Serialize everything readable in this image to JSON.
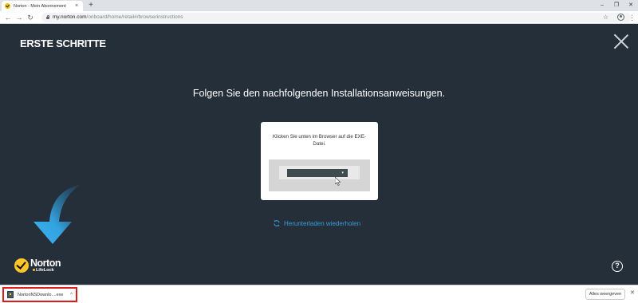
{
  "browser": {
    "tab": {
      "title": "Norton - Mein Abonnement",
      "close": "×"
    },
    "new_tab": "+",
    "window": {
      "minimize": "–",
      "restore": "❐",
      "close": "✕"
    },
    "nav": {
      "back": "←",
      "forward": "→",
      "reload": "↻"
    },
    "url": {
      "host": "my.norton.com",
      "path": "/onboard/home/retail#/browserinstructions"
    },
    "bookmark_icon": "☆",
    "menu_icon": "⋮"
  },
  "page": {
    "header": "ERSTE SCHRITTE",
    "title": "Folgen Sie den nachfolgenden Installationsanweisungen.",
    "card_text": "Klicken Sie unten im Browser auf die EXE-Datei.",
    "demo_arrow": "▾",
    "retry_label": "Herunterladen wiederholen",
    "logo_name": "Norton",
    "logo_sub": "LifeLock",
    "help": "?"
  },
  "download_shelf": {
    "file_name": "NortonNSDownlo....exe",
    "caret": "^",
    "show_all": "Alles weergeven",
    "close": "✕"
  },
  "colors": {
    "page_bg": "#242f3a",
    "accent_blue": "#3a9bd8",
    "highlight_red": "#e01b1b",
    "norton_yellow": "#ffc629"
  }
}
